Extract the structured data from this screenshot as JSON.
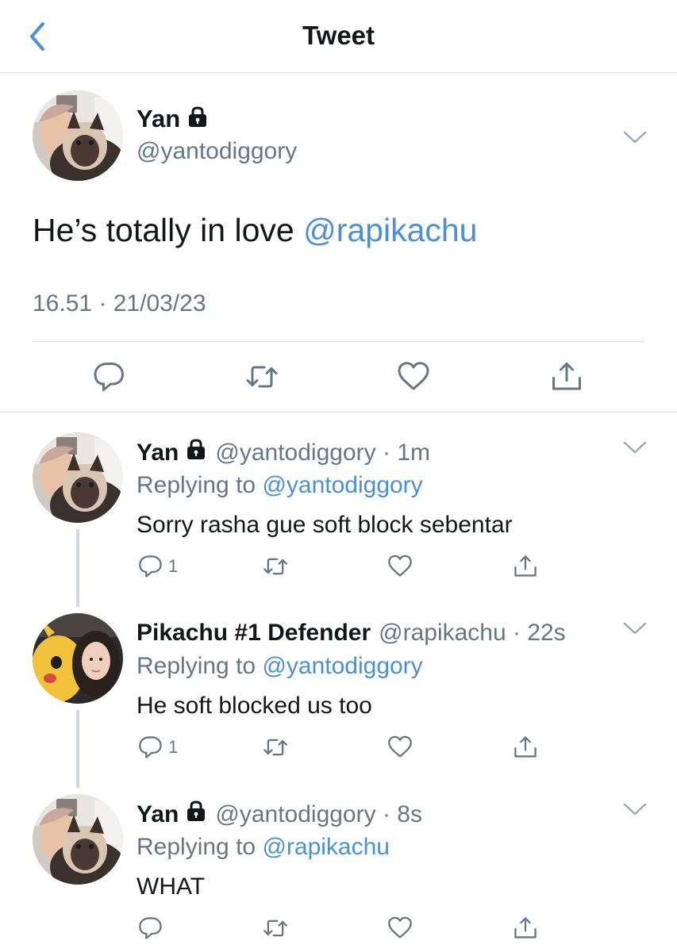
{
  "header": {
    "title": "Tweet",
    "back_icon": "chevron-left-icon"
  },
  "colors": {
    "accent": "#4a90d9",
    "muted": "#657786",
    "text": "#14171a",
    "divider": "#dfe3e6"
  },
  "main_tweet": {
    "name": "Yan",
    "handle": "@yantodiggory",
    "text": "He’s totally in love ",
    "mention": "@rapikachu",
    "timestamp": "16.51 · 21/03/23"
  },
  "replies": [
    {
      "name": "Yan",
      "handle": "@yantodiggory · 1m",
      "replying_prefix": "Replying to ",
      "replying_to": "@yantodiggory",
      "text": "Sorry rasha gue soft block sebentar",
      "reply_count": "1"
    },
    {
      "name": "Pikachu #1 Defender",
      "handle": "@rapikachu · 22s",
      "replying_prefix": "Replying to ",
      "replying_to": "@yantodiggory",
      "text": "He soft blocked us too",
      "reply_count": "1"
    },
    {
      "name": "Yan",
      "handle": "@yantodiggory · 8s",
      "replying_prefix": "Replying to ",
      "replying_to": "@rapikachu",
      "text": "WHAT",
      "reply_count": ""
    }
  ]
}
